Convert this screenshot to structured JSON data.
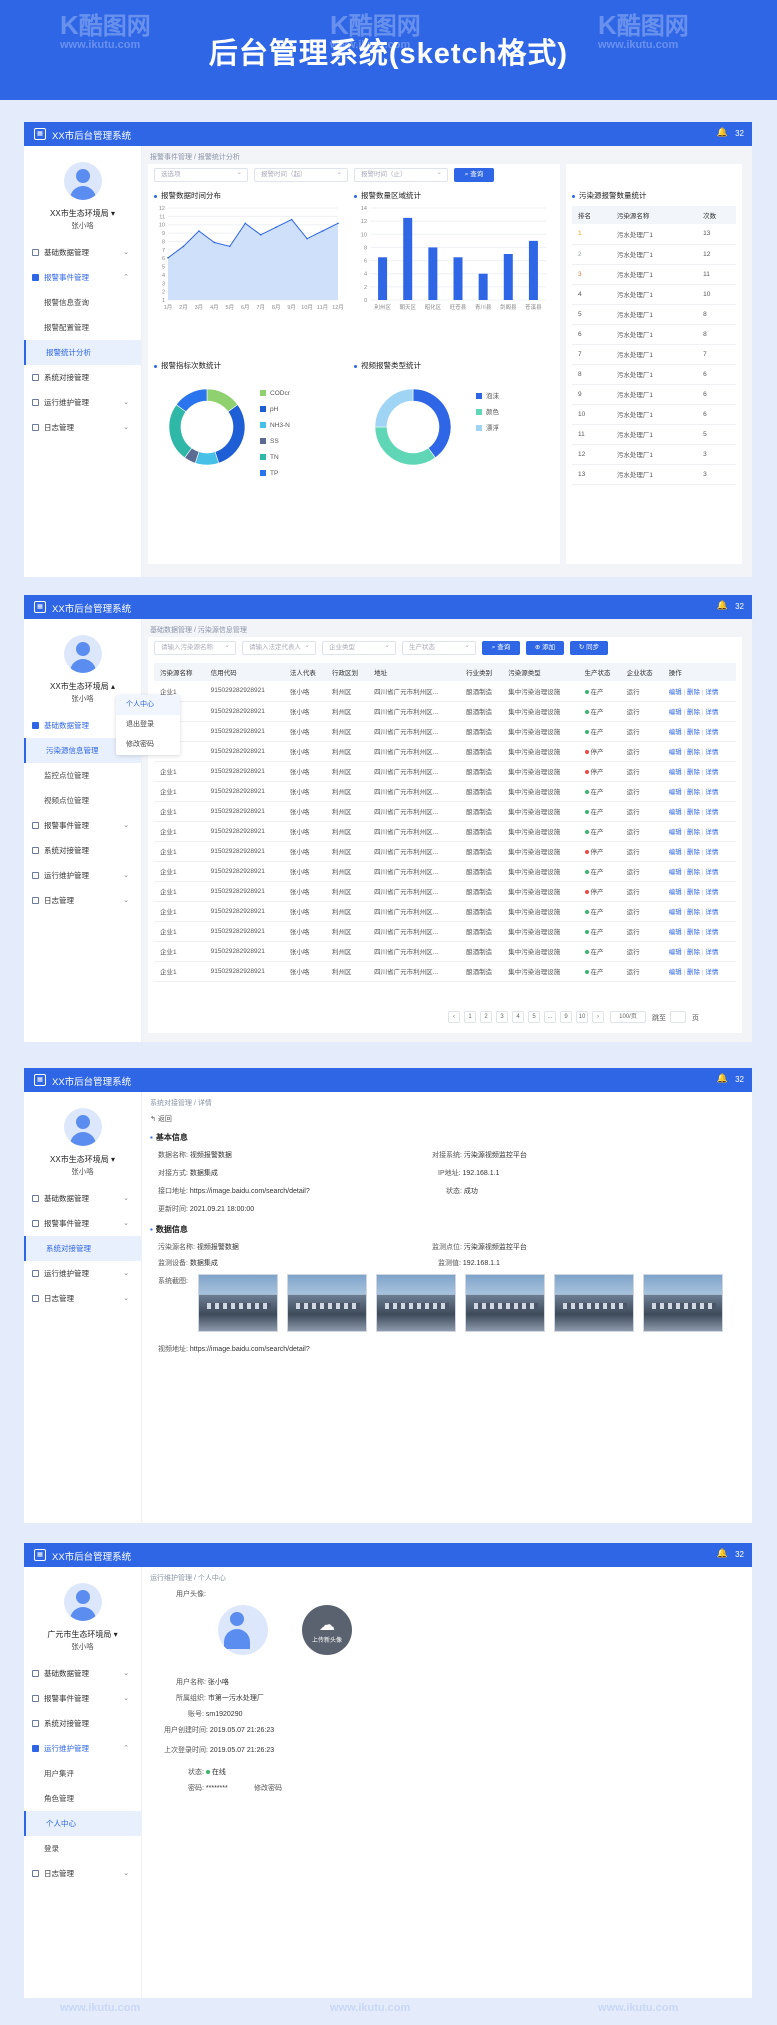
{
  "banner": {
    "title": "后台管理系统(sketch格式)"
  },
  "watermark": {
    "brand": "酷图网",
    "url": "www.ikutu.com"
  },
  "app": {
    "title": "XX市后台管理系统",
    "notif_count": "32"
  },
  "screen1": {
    "org": "XX市生态环境局",
    "user": "张小咯",
    "breadcrumb": "报警事件管理 / 报警统计分析",
    "menu": {
      "m1": "基础数据管理",
      "m2": "报警事件管理",
      "s1": "报警信息查询",
      "s2": "报警配置管理",
      "s3": "报警统计分析",
      "m3": "系统对接管理",
      "m4": "运行维护管理",
      "m5": "日志管理"
    },
    "filters": {
      "f1": "选选项",
      "f2": "报警时间（起）",
      "f3": "报警时间（止）",
      "query": "查询"
    },
    "trend": {
      "title": "报警数据时间分布",
      "chart_data": {
        "type": "area",
        "categories": [
          "1月",
          "2月",
          "3月",
          "4月",
          "5月",
          "6月",
          "7月",
          "8月",
          "9月",
          "10月",
          "11月",
          "12月"
        ],
        "values": [
          5.5,
          7,
          9,
          7.5,
          7,
          10,
          8.5,
          9.5,
          10.5,
          8,
          9,
          10
        ],
        "ylim": [
          0,
          12
        ],
        "yticks": [
          "12",
          "11",
          "10",
          "9",
          "8",
          "7",
          "6",
          "5",
          "4",
          "3",
          "2",
          "1"
        ]
      }
    },
    "region": {
      "title": "报警数量区域统计",
      "chart_data": {
        "type": "bar",
        "categories": [
          "利州区",
          "朝天区",
          "昭化区",
          "旺苍县",
          "青川县",
          "剑阁县",
          "苍溪县"
        ],
        "values": [
          6.5,
          12.5,
          8,
          6.5,
          4,
          7,
          9
        ],
        "ylim": [
          0,
          14
        ],
        "yticks": [
          "14",
          "12",
          "10",
          "8",
          "6",
          "4",
          "2",
          "0"
        ]
      }
    },
    "indicator": {
      "title": "报警指标次数统计",
      "chart_data": {
        "type": "pie",
        "categories": [
          "CODcr",
          "pH",
          "NH3-N",
          "SS",
          "TN",
          "TP"
        ],
        "values": [
          15,
          30,
          10,
          5,
          25,
          15
        ],
        "colors": [
          "#8fd16f",
          "#1f5fd6",
          "#46c0e6",
          "#5b6b94",
          "#2fb8a8",
          "#2a74ee"
        ]
      }
    },
    "vtype": {
      "title": "视频报警类型统计",
      "chart_data": {
        "type": "pie",
        "categories": [
          "泡沫",
          "颜色",
          "漂浮"
        ],
        "values": [
          40,
          35,
          25
        ],
        "colors": [
          "#2f66e6",
          "#5fd6b6",
          "#9fd4f5"
        ]
      }
    },
    "ranking": {
      "title": "污染源报警数量统计",
      "headers": [
        "排名",
        "污染源名称",
        "次数"
      ],
      "rows": [
        [
          "1",
          "污水处理厂1",
          "13"
        ],
        [
          "2",
          "污水处理厂1",
          "12"
        ],
        [
          "3",
          "污水处理厂1",
          "11"
        ],
        [
          "4",
          "污水处理厂1",
          "10"
        ],
        [
          "5",
          "污水处理厂1",
          "8"
        ],
        [
          "6",
          "污水处理厂1",
          "8"
        ],
        [
          "7",
          "污水处理厂1",
          "7"
        ],
        [
          "8",
          "污水处理厂1",
          "6"
        ],
        [
          "9",
          "污水处理厂1",
          "6"
        ],
        [
          "10",
          "污水处理厂1",
          "6"
        ],
        [
          "11",
          "污水处理厂1",
          "5"
        ],
        [
          "12",
          "污水处理厂1",
          "3"
        ],
        [
          "13",
          "污水处理厂1",
          "3"
        ]
      ]
    }
  },
  "screen2": {
    "org": "XX市生态环境局",
    "user": "张小咯",
    "breadcrumb": "基础数据管理 / 污染源信息管理",
    "dropdown": [
      "个人中心",
      "退出登录",
      "修改密码"
    ],
    "menu": {
      "m1": "基础数据管理",
      "s1": "污染源信息管理",
      "s2": "监控点位管理",
      "s3": "视频点位管理",
      "m2": "报警事件管理",
      "m3": "系统对接管理",
      "m4": "运行维护管理",
      "m5": "日志管理"
    },
    "filters": {
      "f1": "请输入污染源名称",
      "f2": "请输入法定代表人",
      "f3": "企业类型",
      "f4": "生产状态",
      "query": "查询",
      "add": "添加",
      "sync": "同步"
    },
    "headers": [
      "污染源名称",
      "信用代码",
      "法人代表",
      "行政区划",
      "地址",
      "行业类别",
      "污染源类型",
      "生产状态",
      "企业状态",
      "操作"
    ],
    "rows": [
      {
        "name": "企业1",
        "code": "915029282928921",
        "rep": "张小咯",
        "area": "利州区",
        "addr": "四川省广元市利州区...",
        "ind": "酿酒制造",
        "type": "集中污染治理设施",
        "state": "在产",
        "ent": "运行"
      },
      {
        "name": "企业1",
        "code": "915029282928921",
        "rep": "张小咯",
        "area": "利州区",
        "addr": "四川省广元市利州区...",
        "ind": "酿酒制造",
        "type": "集中污染治理设施",
        "state": "在产",
        "ent": "运行"
      },
      {
        "name": "企业1",
        "code": "915029282928921",
        "rep": "张小咯",
        "area": "利州区",
        "addr": "四川省广元市利州区...",
        "ind": "酿酒制造",
        "type": "集中污染治理设施",
        "state": "在产",
        "ent": "运行"
      },
      {
        "name": "企业1",
        "code": "915029282928921",
        "rep": "张小咯",
        "area": "利州区",
        "addr": "四川省广元市利州区...",
        "ind": "酿酒制造",
        "type": "集中污染治理设施",
        "state": "停产",
        "ent": "运行"
      },
      {
        "name": "企业1",
        "code": "915029282928921",
        "rep": "张小咯",
        "area": "利州区",
        "addr": "四川省广元市利州区...",
        "ind": "酿酒制造",
        "type": "集中污染治理设施",
        "state": "停产",
        "ent": "运行"
      },
      {
        "name": "企业1",
        "code": "915029282928921",
        "rep": "张小咯",
        "area": "利州区",
        "addr": "四川省广元市利州区...",
        "ind": "酿酒制造",
        "type": "集中污染治理设施",
        "state": "在产",
        "ent": "运行"
      },
      {
        "name": "企业1",
        "code": "915029282928921",
        "rep": "张小咯",
        "area": "利州区",
        "addr": "四川省广元市利州区...",
        "ind": "酿酒制造",
        "type": "集中污染治理设施",
        "state": "在产",
        "ent": "运行"
      },
      {
        "name": "企业1",
        "code": "915029282928921",
        "rep": "张小咯",
        "area": "利州区",
        "addr": "四川省广元市利州区...",
        "ind": "酿酒制造",
        "type": "集中污染治理设施",
        "state": "在产",
        "ent": "运行"
      },
      {
        "name": "企业1",
        "code": "915029282928921",
        "rep": "张小咯",
        "area": "利州区",
        "addr": "四川省广元市利州区...",
        "ind": "酿酒制造",
        "type": "集中污染治理设施",
        "state": "停产",
        "ent": "运行"
      },
      {
        "name": "企业1",
        "code": "915029282928921",
        "rep": "张小咯",
        "area": "利州区",
        "addr": "四川省广元市利州区...",
        "ind": "酿酒制造",
        "type": "集中污染治理设施",
        "state": "在产",
        "ent": "运行"
      },
      {
        "name": "企业1",
        "code": "915029282928921",
        "rep": "张小咯",
        "area": "利州区",
        "addr": "四川省广元市利州区...",
        "ind": "酿酒制造",
        "type": "集中污染治理设施",
        "state": "停产",
        "ent": "运行"
      },
      {
        "name": "企业1",
        "code": "915029282928921",
        "rep": "张小咯",
        "area": "利州区",
        "addr": "四川省广元市利州区...",
        "ind": "酿酒制造",
        "type": "集中污染治理设施",
        "state": "在产",
        "ent": "运行"
      },
      {
        "name": "企业1",
        "code": "915029282928921",
        "rep": "张小咯",
        "area": "利州区",
        "addr": "四川省广元市利州区...",
        "ind": "酿酒制造",
        "type": "集中污染治理设施",
        "state": "在产",
        "ent": "运行"
      },
      {
        "name": "企业1",
        "code": "915029282928921",
        "rep": "张小咯",
        "area": "利州区",
        "addr": "四川省广元市利州区...",
        "ind": "酿酒制造",
        "type": "集中污染治理设施",
        "state": "在产",
        "ent": "运行"
      },
      {
        "name": "企业1",
        "code": "915029282928921",
        "rep": "张小咯",
        "area": "利州区",
        "addr": "四川省广元市利州区...",
        "ind": "酿酒制造",
        "type": "集中污染治理设施",
        "state": "在产",
        "ent": "运行"
      }
    ],
    "ops": {
      "edit": "编辑",
      "del": "删除",
      "detail": "详情"
    },
    "pager": {
      "prev": "‹",
      "p1": "1",
      "p2": "2",
      "p3": "3",
      "p4": "4",
      "p5": "5",
      "dots": "...",
      "p9": "9",
      "p10": "10",
      "next": "›",
      "size": "100/页",
      "goto": "跳至",
      "unit": "页"
    }
  },
  "screen3": {
    "org": "XX市生态环境局",
    "user": "张小咯",
    "breadcrumb": "系统对接管理 / 详情",
    "back": "返回",
    "menu": {
      "m1": "基础数据管理",
      "m2": "报警事件管理",
      "m3": "系统对接管理",
      "m4": "运行维护管理",
      "m5": "日志管理"
    },
    "basic": {
      "title": "基本信息",
      "name_label": "数据名称:",
      "name": "视频报警数据",
      "target_label": "对接系统:",
      "target": "污染源视频监控平台",
      "mode_label": "对接方式:",
      "mode": "数据集成",
      "ip_label": "IP地址:",
      "ip": "192.168.1.1",
      "url_label": "接口地址:",
      "url": "https://image.baidu.com/search/detail?",
      "status_label": "状态:",
      "status": "成功",
      "time_label": "更新时间:",
      "time": "2021.09.21 18:00:00"
    },
    "data": {
      "title": "数据信息",
      "src_label": "污染源名称:",
      "src": "视频报警数据",
      "point_label": "监测点位:",
      "point": "污染源视频监控平台",
      "mode_label": "监测设备:",
      "mode": "数据集成",
      "ip_label": "监测值:",
      "ip": "192.168.1.1",
      "shots_label": "系统截图:",
      "video_label": "视频地址:",
      "video": "https://image.baidu.com/search/detail?"
    }
  },
  "screen4": {
    "org": "广元市生态环境局",
    "user": "张小咯",
    "breadcrumb": "运行维护管理 / 个人中心",
    "menu": {
      "m1": "基础数据管理",
      "m2": "报警事件管理",
      "m3": "系统对接管理",
      "m4": "运行维护管理",
      "s1": "用户集评",
      "s2": "角色管理",
      "s3": "个人中心",
      "s4": "登录",
      "m5": "日志管理"
    },
    "profile": {
      "avatar_label": "用户头像:",
      "upload": "上传新头像",
      "name_label": "用户名称:",
      "name": "张小咯",
      "org_label": "所属组织:",
      "org": "市第一污水处理厂",
      "acct_label": "账号:",
      "acct": "sm1920290",
      "created_label": "用户创建时间:",
      "created": "2019.05.07 21:26:23",
      "last_label": "上次登录时间:",
      "last": "2019.05.07 21:26:23",
      "status_label": "状态:",
      "status": "在线",
      "pwd_label": "密码:",
      "pwd": "********",
      "change": "修改密码"
    }
  }
}
